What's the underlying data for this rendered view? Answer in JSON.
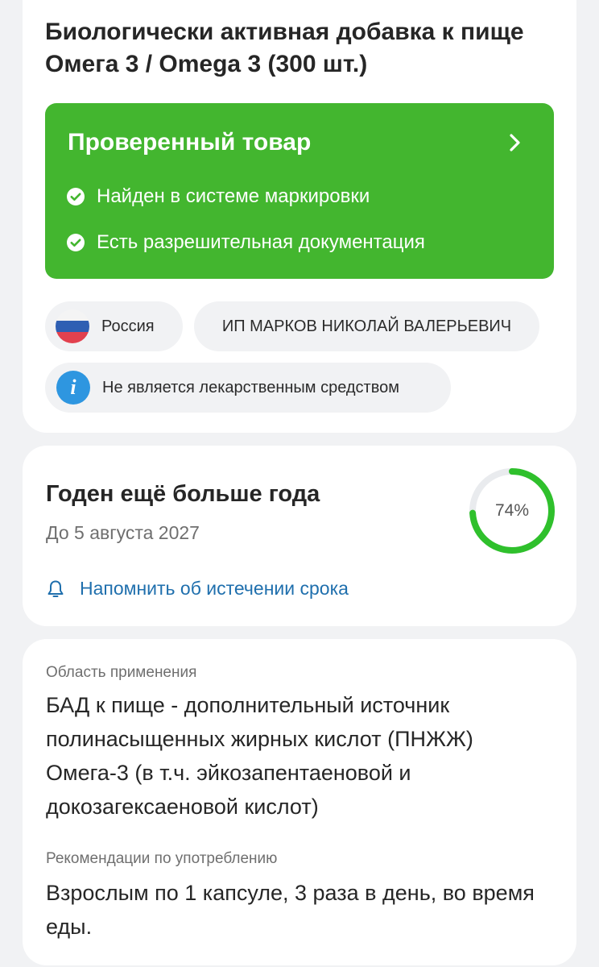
{
  "product": {
    "title": "Биологически активная добавка к пище Омега 3 / Omega 3 (300 шт.)"
  },
  "verified": {
    "title": "Проверенный товар",
    "checks": [
      "Найден в системе маркировки",
      "Есть разрешительная документация"
    ],
    "color": "#43b62f"
  },
  "chips": {
    "country": "Россия",
    "manufacturer": "ИП МАРКОВ НИКОЛАЙ ВАЛЕРЬЕВИЧ",
    "not_medicine": "Не является лекарственным средством"
  },
  "expiry": {
    "title": "Годен ещё больше года",
    "date": "До 5 августа 2027",
    "percent_label": "74%",
    "percent_value": 0.74,
    "ring_color": "#2fc02c",
    "remind_label": "Напомнить об истечении срока"
  },
  "details": {
    "usage_label": "Область применения",
    "usage_text": "БАД к пище - дополнительный источник полинасыщенных жирных кислот (ПНЖЖ) Омега-3 (в т.ч. эйкозапентаеновой и докозагексаеновой кислот)",
    "reco_label": "Рекомендации по употреблению",
    "reco_text": "Взрослым по 1 капсуле, 3 раза в день, во время еды."
  },
  "icons": {
    "chevron": "chevron-right-icon",
    "check": "check-circle-icon",
    "flag": "russia-flag-icon",
    "info": "info-icon",
    "bell": "bell-icon"
  }
}
